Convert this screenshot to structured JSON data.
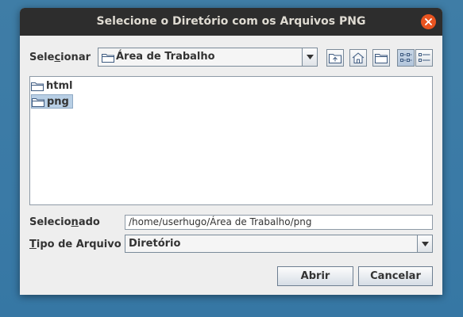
{
  "window": {
    "title": "Selecione o Diretório com os Arquivos PNG"
  },
  "look_in": {
    "label_pre": "Sele",
    "label_mnemonic": "c",
    "label_post": "ionar",
    "value": "Área de Trabalho"
  },
  "toolbar": {
    "icons": [
      "up-folder-icon",
      "home-icon",
      "new-folder-icon",
      "list-view-icon",
      "details-view-icon"
    ]
  },
  "files": [
    {
      "name": "html",
      "selected": false
    },
    {
      "name": "png",
      "selected": true
    }
  ],
  "selected_field": {
    "label_pre": "Selecio",
    "label_mnemonic": "n",
    "label_post": "ado",
    "value": "/home/userhugo/Área de Trabalho/png"
  },
  "file_type": {
    "label_mnemonic": "T",
    "label_post": "ipo de Arquivo",
    "value": "Diretório"
  },
  "buttons": {
    "open": "Abrir",
    "cancel": "Cancelar"
  },
  "colors": {
    "close": "#e95420",
    "titlebar": "#2d2d2d",
    "selection": "#b8cfe5"
  }
}
